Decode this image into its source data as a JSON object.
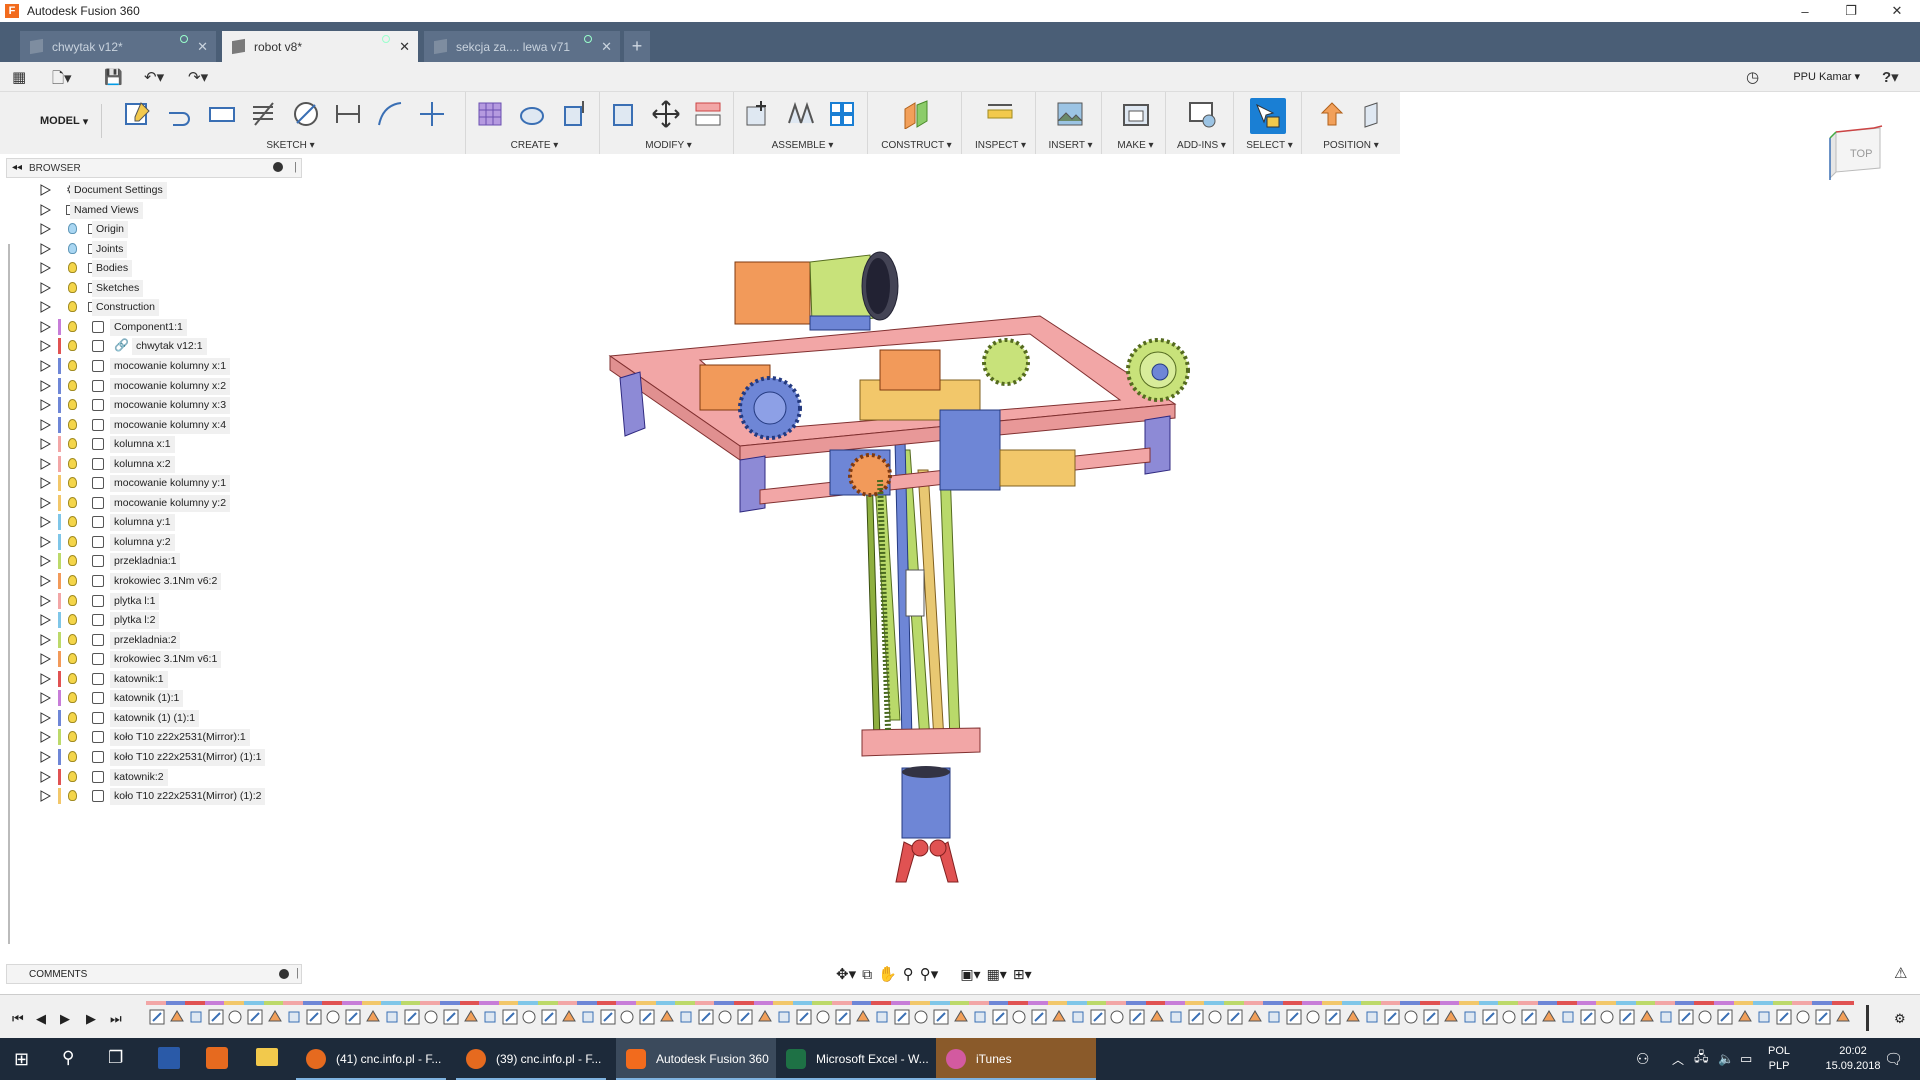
{
  "window": {
    "title": "Autodesk Fusion 360",
    "minimize": "–",
    "restore": "❐",
    "close": "✕"
  },
  "tabs": [
    {
      "label": "chwytak v12*"
    },
    {
      "label": "robot v8*"
    },
    {
      "label": "sekcja za.... lewa v71"
    }
  ],
  "new_tab": "+",
  "user": "PPU Kamar",
  "help": "?",
  "ribbon": {
    "workspace": "MODEL",
    "groups": [
      "SKETCH",
      "CREATE",
      "MODIFY",
      "ASSEMBLE",
      "CONSTRUCT",
      "INSPECT",
      "INSERT",
      "MAKE",
      "ADD-INS",
      "SELECT",
      "POSITION"
    ]
  },
  "browser": {
    "title": "BROWSER",
    "items": [
      {
        "label": "Document Settings",
        "kind": "settings"
      },
      {
        "label": "Named Views",
        "kind": "folder"
      },
      {
        "label": "Origin",
        "kind": "folder",
        "bulb": "blue"
      },
      {
        "label": "Joints",
        "kind": "folder",
        "bulb": "blue"
      },
      {
        "label": "Bodies",
        "kind": "folder",
        "bulb": "yellow"
      },
      {
        "label": "Sketches",
        "kind": "folder",
        "bulb": "yellow"
      },
      {
        "label": "Construction",
        "kind": "folder",
        "bulb": "yellow"
      },
      {
        "label": "Component1:1",
        "kind": "component",
        "color": "#c77dd8"
      },
      {
        "label": "chwytak v12:1",
        "kind": "link",
        "color": "#e05252"
      },
      {
        "label": "mocowanie kolumny x:1",
        "kind": "component",
        "color": "#6e86d6"
      },
      {
        "label": "mocowanie kolumny x:2",
        "kind": "component",
        "color": "#6e86d6"
      },
      {
        "label": "mocowanie kolumny x:3",
        "kind": "component",
        "color": "#6e86d6"
      },
      {
        "label": "mocowanie kolumny x:4",
        "kind": "component",
        "color": "#6e86d6"
      },
      {
        "label": "kolumna x:1",
        "kind": "component",
        "color": "#f2a6a6"
      },
      {
        "label": "kolumna x:2",
        "kind": "component",
        "color": "#f2a6a6"
      },
      {
        "label": "mocowanie kolumny y:1",
        "kind": "component",
        "color": "#f2c76a"
      },
      {
        "label": "mocowanie kolumny y:2",
        "kind": "component",
        "color": "#f2c76a"
      },
      {
        "label": "kolumna y:1",
        "kind": "component",
        "color": "#7fc6e8"
      },
      {
        "label": "kolumna y:2",
        "kind": "component",
        "color": "#7fc6e8"
      },
      {
        "label": "przekladnia:1",
        "kind": "component",
        "color": "#bcd96a"
      },
      {
        "label": "krokowiec 3.1Nm v6:2",
        "kind": "component",
        "color": "#f29a5a"
      },
      {
        "label": "plytka l:1",
        "kind": "component",
        "color": "#f2a6a6"
      },
      {
        "label": "plytka l:2",
        "kind": "component",
        "color": "#7fc6e8"
      },
      {
        "label": "przekladnia:2",
        "kind": "component",
        "color": "#bcd96a"
      },
      {
        "label": "krokowiec 3.1Nm v6:1",
        "kind": "component",
        "color": "#f29a5a"
      },
      {
        "label": "katownik:1",
        "kind": "component",
        "color": "#e05252"
      },
      {
        "label": "katownik (1):1",
        "kind": "component",
        "color": "#c77dd8"
      },
      {
        "label": "katownik (1) (1):1",
        "kind": "component",
        "color": "#6e86d6"
      },
      {
        "label": "koło T10 z22x2531(Mirror):1",
        "kind": "component",
        "color": "#bcd96a"
      },
      {
        "label": "koło T10 z22x2531(Mirror) (1):1",
        "kind": "component",
        "color": "#6e86d6"
      },
      {
        "label": "katownik:2",
        "kind": "component",
        "color": "#e05252"
      },
      {
        "label": "koło T10 z22x2531(Mirror) (1):2",
        "kind": "component",
        "color": "#f2c76a"
      }
    ]
  },
  "comments": {
    "title": "COMMENTS"
  },
  "viewcube": {
    "face": "TOP"
  },
  "taskbar": {
    "apps": [
      {
        "label": "(41) cnc.info.pl - F...",
        "color": "#e66a1f"
      },
      {
        "label": "(39) cnc.info.pl - F...",
        "color": "#e66a1f"
      },
      {
        "label": "Autodesk Fusion 360",
        "color": "#f26b1d"
      },
      {
        "label": "Microsoft Excel - W...",
        "color": "#1e7145"
      },
      {
        "label": "iTunes",
        "color": "#d35aa0"
      }
    ],
    "lang1": "POL",
    "lang2": "PLP",
    "time": "20:02",
    "date": "15.09.2018"
  }
}
